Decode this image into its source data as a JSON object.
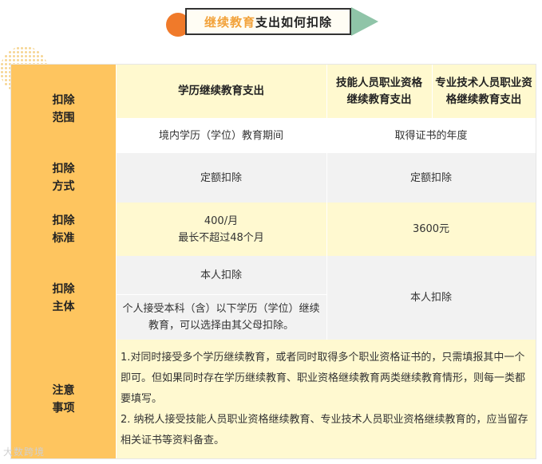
{
  "banner": {
    "title_highlight": "继续教育",
    "title_rest": "支出如何扣除"
  },
  "table": {
    "headers": {
      "col1": "学历继续教育支出",
      "col2": "技能人员职业资格继续教育支出",
      "col3": "专业技术人员职业资格继续教育支出"
    },
    "rows": {
      "scope": {
        "label": "扣除\n范围",
        "col1": "境内学历（学位）教育期间",
        "col23": "取得证书的年度"
      },
      "method": {
        "label": "扣除\n方式",
        "col1": "定额扣除",
        "col23": "定额扣除"
      },
      "standard": {
        "label": "扣除\n标准",
        "col1": "400/月\n最长不超过48个月",
        "col23": "3600元"
      },
      "subject": {
        "label": "扣除\n主体",
        "col1_top": "本人扣除",
        "col1_bottom": "个人接受本科（含）以下学历（学位）继续教育，可以选择由其父母扣除。",
        "col23": "本人扣除"
      },
      "notes": {
        "label": "注意\n事项",
        "item1": "1.对同时接受多个学历继续教育，或者同时取得多个职业资格证书的，只需填报其中一个即可。但如果同时存在学历继续教育、职业资格继续教育两类继续教育情形，则每一类都要填写。",
        "item2": "2. 纳税人接受技能人员职业资格继续教育、专业技术人员职业资格继续教育的，应当留存相关证书等资料备查。"
      }
    }
  },
  "watermark": "大数跨境"
}
